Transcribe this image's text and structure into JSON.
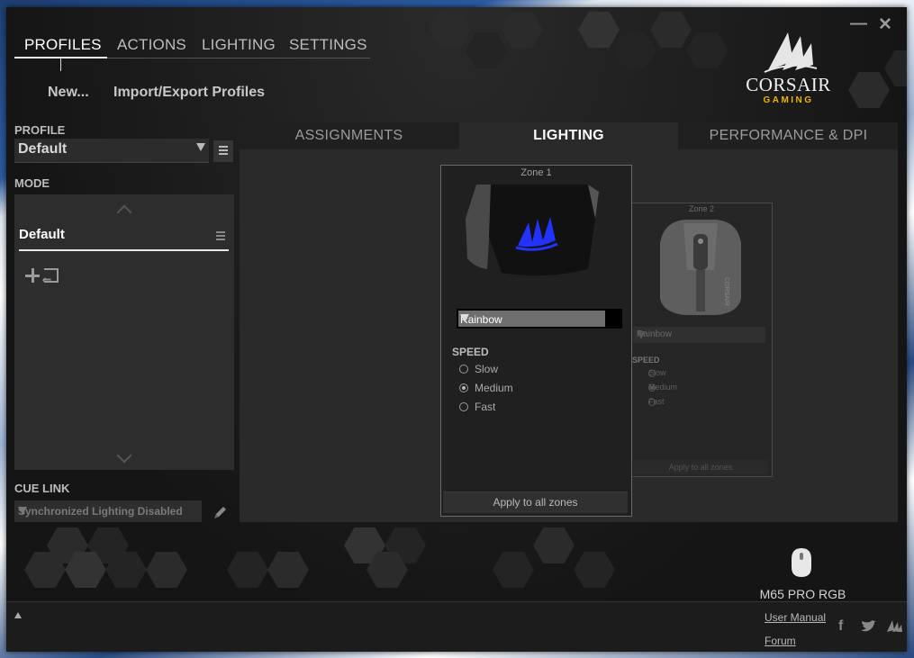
{
  "window": {
    "close_glyph": "✕",
    "minimize_glyph": "—"
  },
  "top_nav": {
    "items": [
      "PROFILES",
      "ACTIONS",
      "LIGHTING",
      "SETTINGS"
    ],
    "active": "PROFILES"
  },
  "profile_actions": {
    "new_label": "New...",
    "import_export_label": "Import/Export Profiles"
  },
  "logo": {
    "brand": "CORSAIR",
    "sub": "GAMING"
  },
  "sidebar": {
    "profile_label": "PROFILE",
    "profile_value": "Default",
    "mode_label": "MODE",
    "mode_items": [
      {
        "label": "Default",
        "selected": true
      }
    ],
    "cue_link_label": "CUE LINK",
    "cue_link_value": "Synchronized Lighting Disabled"
  },
  "main_tabs": {
    "items": [
      "ASSIGNMENTS",
      "LIGHTING",
      "PERFORMANCE & DPI"
    ],
    "active": "LIGHTING"
  },
  "zone1": {
    "title": "Zone 1",
    "effect": "Rainbow",
    "speed_label": "SPEED",
    "speed_options": [
      "Slow",
      "Medium",
      "Fast"
    ],
    "speed_selected": "Medium",
    "apply_label": "Apply to all zones"
  },
  "zone2": {
    "title": "Zone 2",
    "effect": "Rainbow",
    "speed_label": "SPEED",
    "speed_options": [
      "Slow",
      "Medium",
      "Fast"
    ],
    "speed_selected": "Medium",
    "apply_label": "Apply to all zones"
  },
  "device": {
    "name": "M65 PRO RGB",
    "icon": "mouse-icon"
  },
  "footer": {
    "user_manual_label": "User Manual",
    "forum_label": "Forum",
    "social_icons": [
      "facebook-icon",
      "twitter-icon",
      "corsair-icon"
    ],
    "facebook_glyph": "f"
  },
  "colors": {
    "accent": "#e8b400",
    "logo_blue": "#2233ff",
    "panel": "#2a2a2a"
  }
}
